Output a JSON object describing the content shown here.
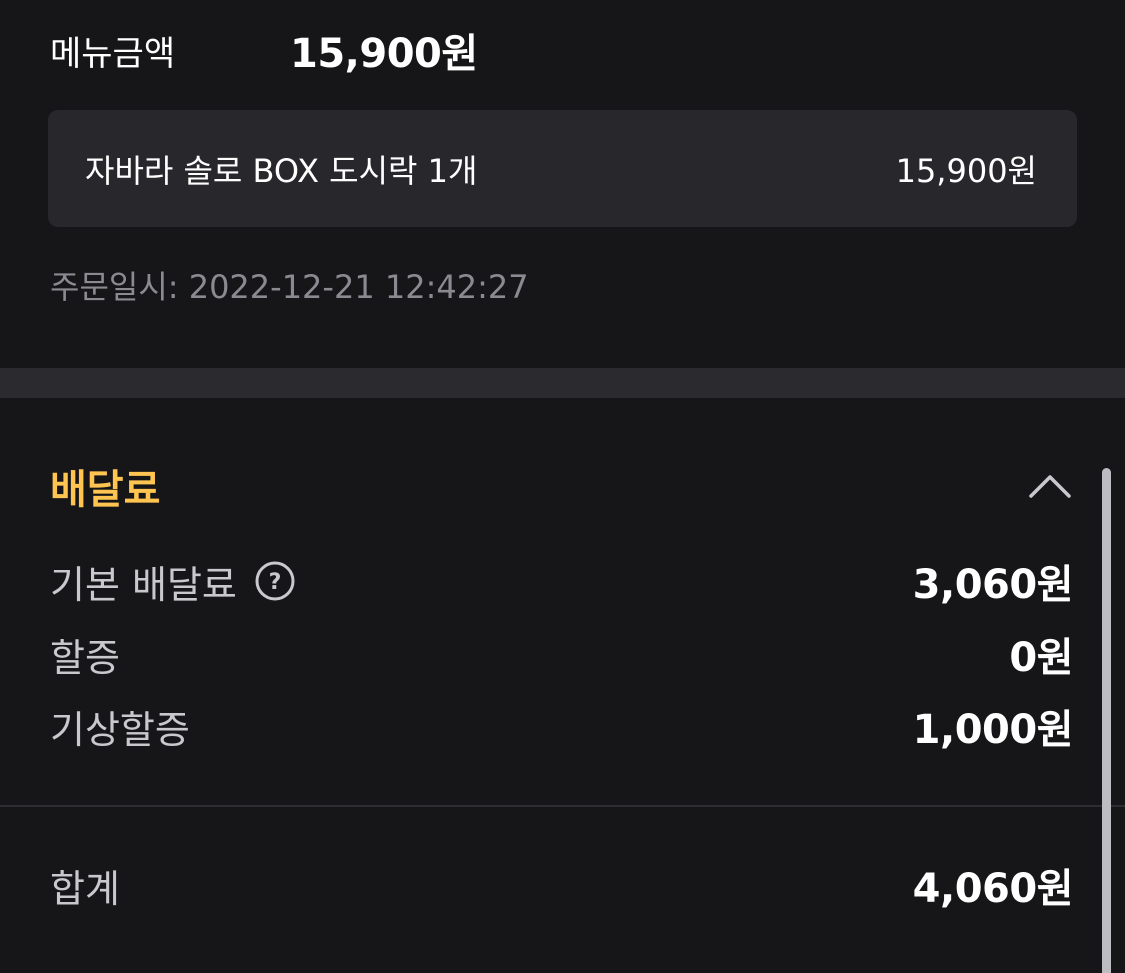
{
  "menu_amount": {
    "label": "메뉴금액",
    "value": "15,900원"
  },
  "order_item": {
    "name": "자바라 솔로 BOX 도시락 1개",
    "price": "15,900원"
  },
  "order_date": "주문일시: 2022-12-21 12:42:27",
  "delivery_fee": {
    "title": "배달료",
    "collapse_icon": "chevron-up-icon",
    "rows": [
      {
        "label": "기본 배달료",
        "value": "3,060원",
        "has_help": true,
        "help_icon": "question-circle-icon"
      },
      {
        "label": "할증",
        "value": "0원"
      },
      {
        "label": "기상할증",
        "value": "1,000원"
      }
    ],
    "total": {
      "label": "합계",
      "value": "4,060원"
    }
  },
  "colors": {
    "background": "#161618",
    "card": "#28272c",
    "accent": "#ffc550",
    "muted_text": "#8b8a90"
  }
}
